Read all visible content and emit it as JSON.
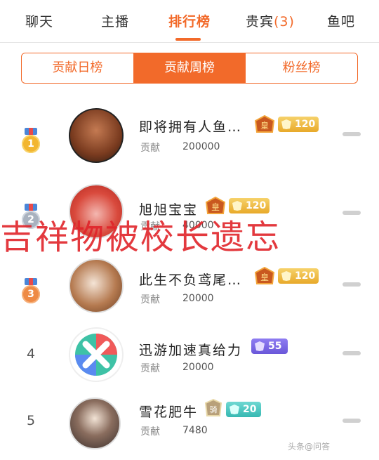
{
  "top_tabs": [
    {
      "label": "聊天"
    },
    {
      "label": "主播"
    },
    {
      "label": "排行榜"
    },
    {
      "label": "贵宾",
      "count": "(3)"
    },
    {
      "label": "鱼吧"
    }
  ],
  "segments": [
    {
      "label": "贡献日榜"
    },
    {
      "label": "贡献周榜"
    },
    {
      "label": "粉丝榜"
    }
  ],
  "contrib_label": "贡献",
  "rows": [
    {
      "rank": "1",
      "name": "即将拥有人鱼…",
      "value": "200000",
      "level": "120"
    },
    {
      "rank": "2",
      "name": "旭旭宝宝",
      "value": "40000",
      "level": "120"
    },
    {
      "rank": "3",
      "name": "此生不负鸢尾…",
      "value": "20000",
      "level": "120"
    },
    {
      "rank": "4",
      "name": "迅游加速真给力",
      "value": "20000",
      "level": "55"
    },
    {
      "rank": "5",
      "name": "雪花肥牛",
      "value": "7480",
      "level": "20"
    }
  ],
  "badge_crown_text": "皇",
  "badge_ride_text": "骑",
  "watermark": "吉祥物被校长遗忘",
  "corner_logo": "头条@问答",
  "colors": {
    "accent": "#f26a2a",
    "watermark": "#e0242a"
  }
}
